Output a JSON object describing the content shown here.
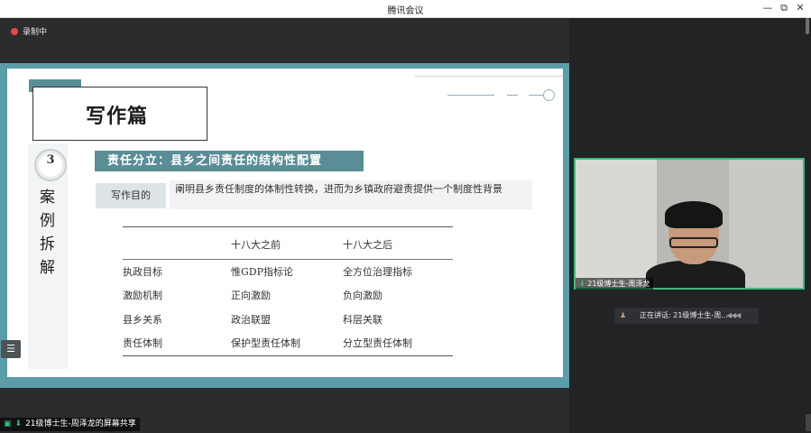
{
  "window": {
    "title": "腾讯会议",
    "controls": {
      "minimize": "—",
      "restore": "⧉",
      "close": "✕"
    }
  },
  "recording": {
    "label": "录制中",
    "icon": "cloud-record-icon"
  },
  "slide": {
    "title": "写作篇",
    "section_number": "3",
    "vertical_label": [
      "案",
      "例",
      "拆",
      "解"
    ],
    "subhead": "责任分立：县乡之间责任的结构性配置",
    "purpose_label": "写作目的",
    "purpose_text": "阐明县乡责任制度的体制性转换，进而为乡镇政府避责提供一个制度性背景",
    "table": {
      "columns": [
        "",
        "十八大之前",
        "十八大之后"
      ],
      "rows": [
        [
          "执政目标",
          "惟GDP指标论",
          "全方位治理指标"
        ],
        [
          "激励机制",
          "正向激励",
          "负向激励"
        ],
        [
          "县乡关系",
          "政治联盟",
          "科层关联"
        ],
        [
          "责任体制",
          "保护型责任体制",
          "分立型责任体制"
        ]
      ]
    }
  },
  "video": {
    "participant_label": "21级博士生-周泽龙",
    "mic_icon": "mic-icon"
  },
  "speaking": {
    "prefix": "正在讲话: ",
    "name": "21级博士生-周..."
  },
  "share": {
    "label": "21级博士生-周泽龙的屏幕共享"
  },
  "colors": {
    "accent": "#5a8d96",
    "frame": "#5b9da8",
    "active": "#3fb87a"
  }
}
